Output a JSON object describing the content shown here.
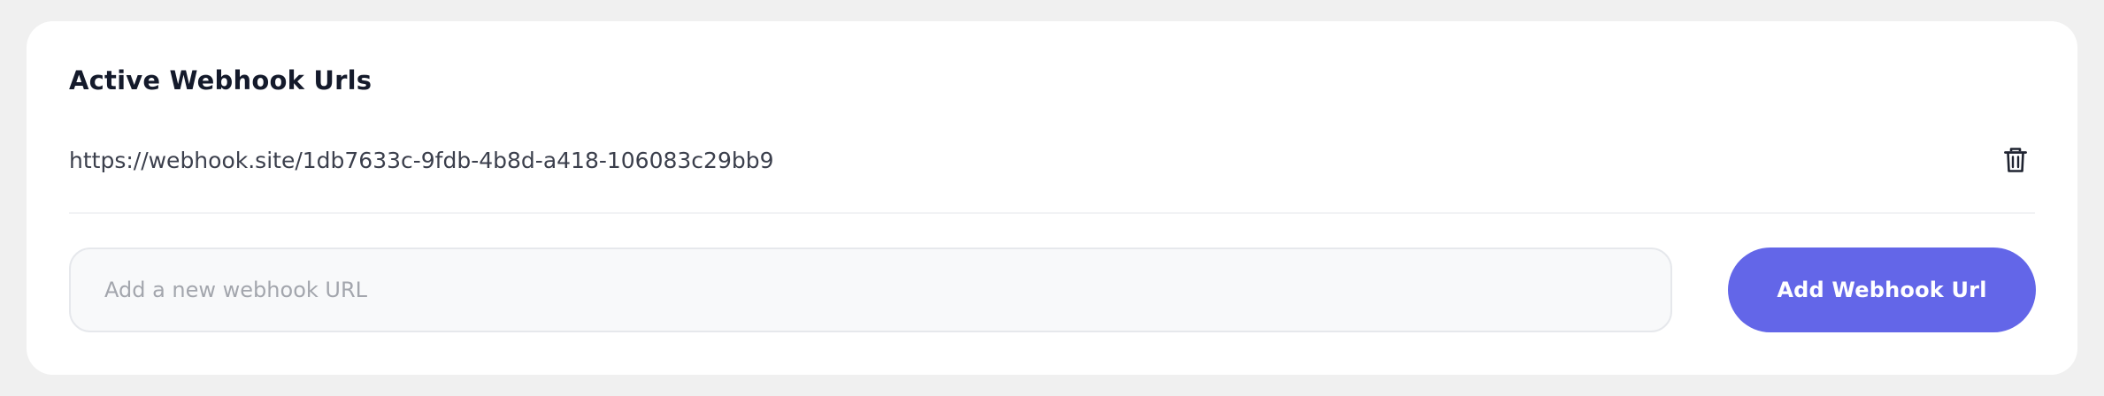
{
  "section": {
    "title": "Active Webhook Urls"
  },
  "webhooks": [
    {
      "url": "https://webhook.site/1db7633c-9fdb-4b8d-a418-106083c29bb9",
      "delete_icon": "trash-icon"
    }
  ],
  "new_webhook": {
    "placeholder": "Add a new webhook URL",
    "value": "",
    "add_label": "Add Webhook Url"
  },
  "colors": {
    "accent": "#6366e8",
    "page_background": "#f0f0f0",
    "card_background": "#ffffff",
    "input_background": "#f8f9fa",
    "title_text": "#141a2b",
    "body_text": "#3b3f4c",
    "placeholder_text": "#a3a6ad"
  }
}
